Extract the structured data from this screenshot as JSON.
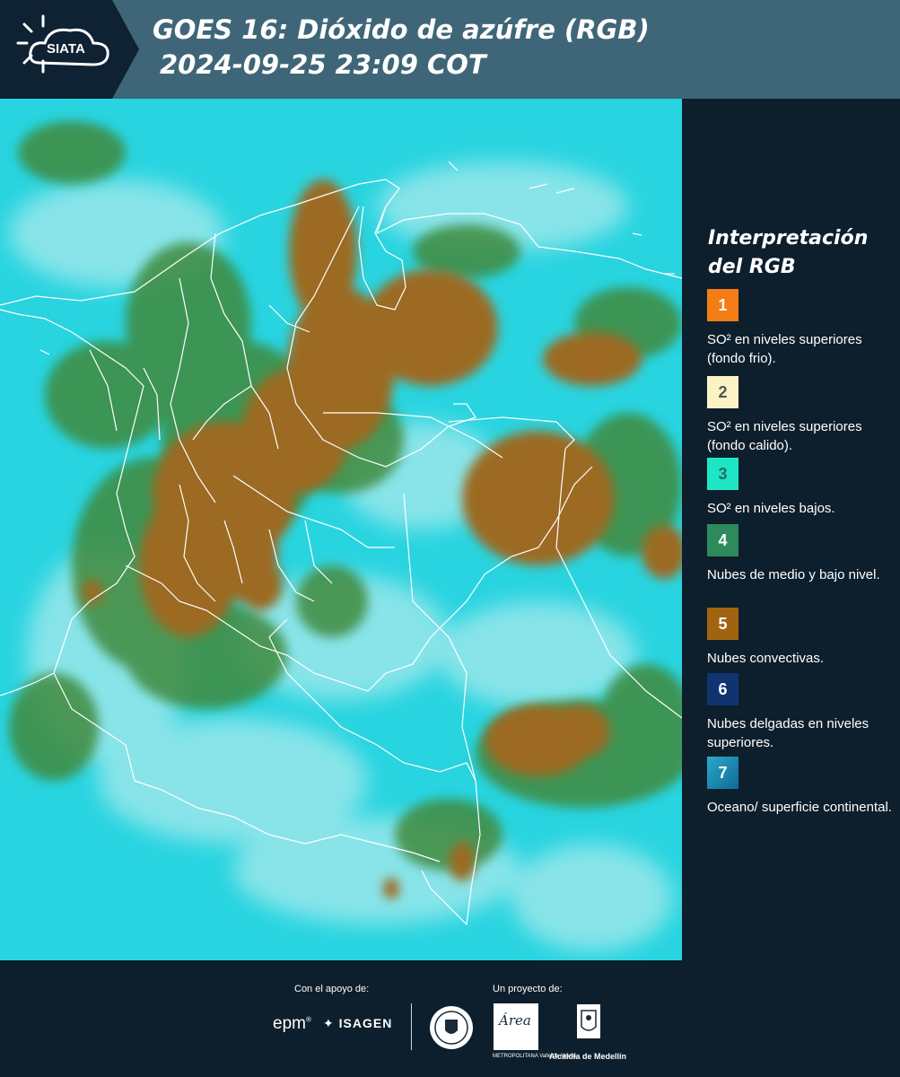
{
  "header": {
    "logo_text": "SIATA",
    "title_line1": "GOES 16: Dióxido de azúfre (RGB)",
    "title_line2": "2024-09-25 23:09 COT"
  },
  "legend": {
    "title": "Interpretación del RGB",
    "items": [
      {
        "number": "1",
        "color": "#f47c14",
        "text_color": "#ffffff",
        "label": "SO² en niveles superiores (fondo frio)."
      },
      {
        "number": "2",
        "color": "#fcf3c4",
        "text_color": "#555555",
        "label": "SO² en niveles superiores (fondo calido)."
      },
      {
        "number": "3",
        "color": "#1ee6c4",
        "text_color": "#2a6a66",
        "label": "SO² en niveles bajos."
      },
      {
        "number": "4",
        "color": "#2e8a5a",
        "text_color": "#ffffff",
        "label": "Nubes de medio y bajo nivel."
      },
      {
        "number": "5",
        "color": "#a06410",
        "text_color": "#ffffff",
        "label": "Nubes convectivas."
      },
      {
        "number": "6",
        "color": "#0f3470",
        "text_color": "#ffffff",
        "label": "Nubes delgadas en niveles superiores."
      },
      {
        "number": "7",
        "color": "#1e8fb0",
        "text_color": "#ffffff",
        "label": "Oceano/ superficie continental."
      }
    ]
  },
  "footer": {
    "support_caption": "Con el apoyo de:",
    "project_caption": "Un proyecto de:",
    "epm": "epm",
    "isagen": "ISAGEN",
    "amva_word": "Área",
    "amva_sub": "METROPOLITANA Valle de Aburrá",
    "alcaldia": "Alcaldía de Medellín"
  },
  "map_colors": {
    "background": "#28d4e0",
    "convective": "#9c6a22",
    "mid_low": "#3f8a3c",
    "pale": "#9fe6e8",
    "boundaries": "#ffffff"
  }
}
